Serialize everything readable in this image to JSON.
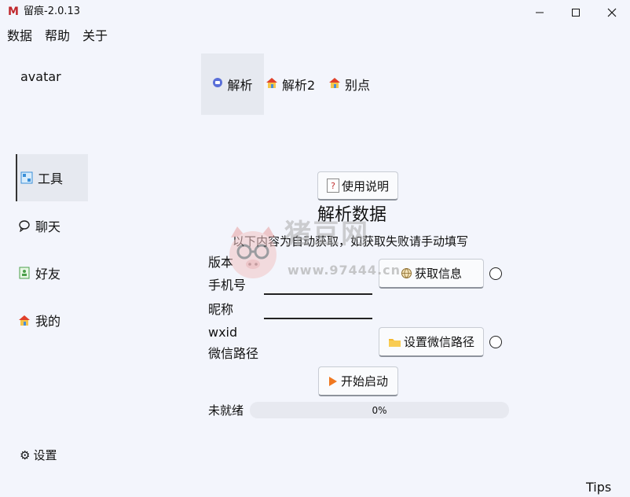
{
  "window": {
    "title": "留痕-2.0.13",
    "logo_text": "M"
  },
  "menu": {
    "items": [
      "数据",
      "帮助",
      "关于"
    ]
  },
  "sidebar": {
    "avatar": "avatar",
    "items": [
      {
        "label": "工具",
        "icon": "tools-icon"
      },
      {
        "label": "聊天",
        "icon": "chat-icon"
      },
      {
        "label": "好友",
        "icon": "contacts-icon"
      },
      {
        "label": "我的",
        "icon": "home-icon"
      }
    ],
    "settings": "设置"
  },
  "tabs": [
    "解析",
    "解析2",
    "别点"
  ],
  "content": {
    "help_button": "使用说明",
    "heading": "解析数据",
    "subtitle": "以下内容为自动获取，如获取失败请手动填写",
    "labels": {
      "version": "版本",
      "phone": "手机号",
      "nickname": "昵称",
      "wxid": "wxid",
      "wechat_path": "微信路径"
    },
    "get_info_button": "获取信息",
    "set_path_button": "设置微信路径",
    "start_button": "开始启动",
    "status": "未就绪",
    "progress_text": "0%",
    "progress_value": 0
  },
  "tips": "Tips",
  "watermark": {
    "text": "猪豆网",
    "url": "www.97444.cn"
  },
  "colors": {
    "background": "#f3f5fc",
    "logo": "#c0282d",
    "start_icon": "#f07820",
    "folder_icon": "#f5b82e"
  }
}
